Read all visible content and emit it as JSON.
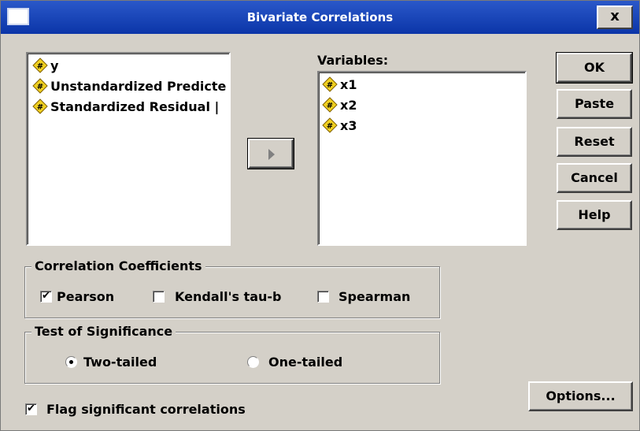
{
  "window": {
    "title": "Bivariate Correlations",
    "close_label": "x"
  },
  "source_list": {
    "items": [
      "y",
      "Unstandardized Predicte",
      "Standardized Residual |"
    ]
  },
  "variables": {
    "label": "Variables:",
    "items": [
      "x1",
      "x2",
      "x3"
    ]
  },
  "buttons": {
    "ok": "OK",
    "paste": "Paste",
    "reset": "Reset",
    "cancel": "Cancel",
    "help": "Help",
    "options": "Options..."
  },
  "correlation_coefficients": {
    "legend": "Correlation Coefficients",
    "pearson": {
      "label": "Pearson",
      "checked": true
    },
    "kendall": {
      "label": "Kendall's tau-b",
      "checked": false
    },
    "spearman": {
      "label": "Spearman",
      "checked": false
    }
  },
  "test_of_significance": {
    "legend": "Test of Significance",
    "two_tailed": {
      "label": "Two-tailed",
      "selected": true
    },
    "one_tailed": {
      "label": "One-tailed",
      "selected": false
    }
  },
  "flag_significant": {
    "label": "Flag significant correlations",
    "checked": true
  },
  "icons": {
    "variable": "numeric-variable-icon",
    "move": "right-arrow-icon"
  }
}
